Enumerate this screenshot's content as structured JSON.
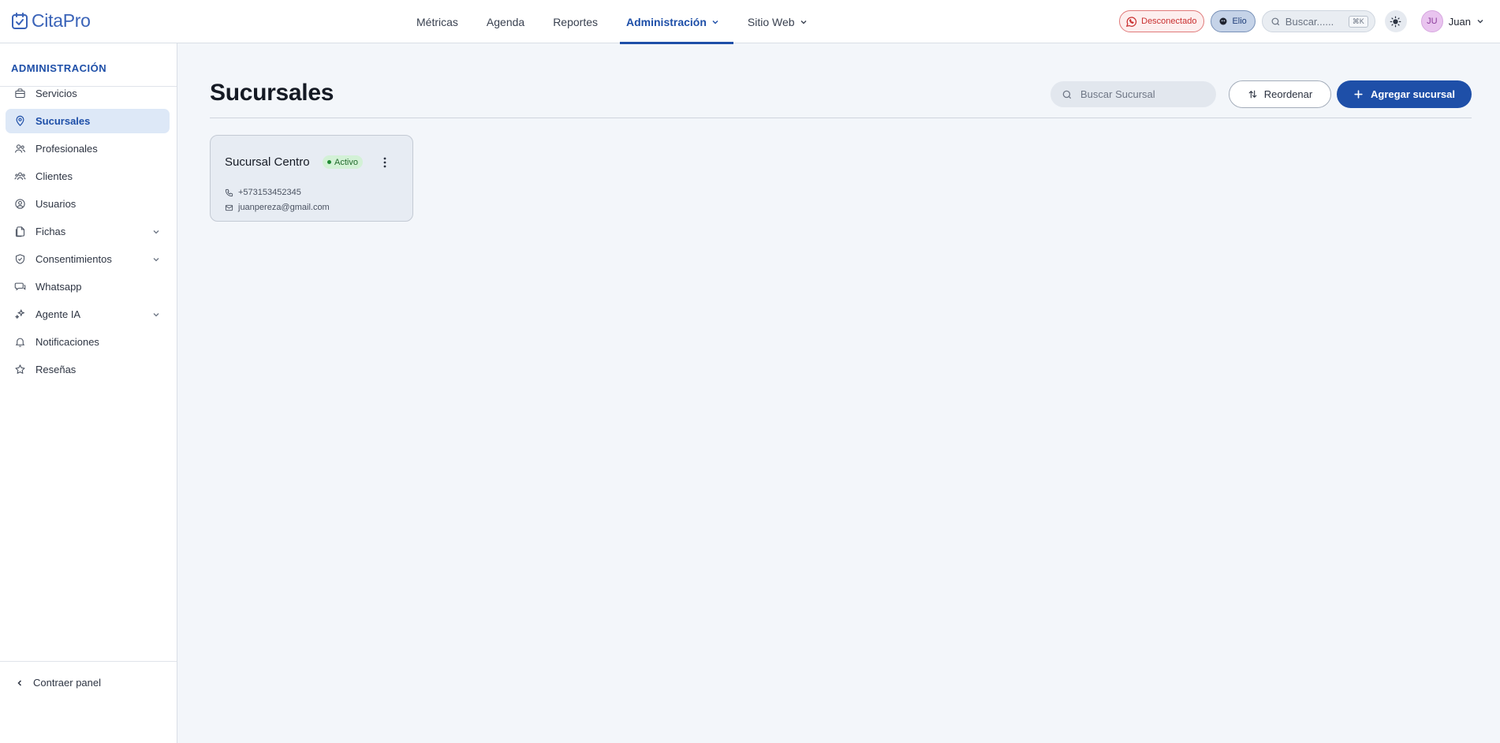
{
  "app": {
    "name": "CitaPro"
  },
  "nav": {
    "items": [
      {
        "label": "Métricas"
      },
      {
        "label": "Agenda"
      },
      {
        "label": "Reportes"
      },
      {
        "label": "Administración"
      },
      {
        "label": "Sitio Web"
      }
    ],
    "active": "Administración"
  },
  "topbar": {
    "whatsapp_status": "Desconectado",
    "assistant_label": "Elio",
    "search_placeholder": "Buscar......",
    "search_shortcut": "⌘K",
    "user_initials": "JU",
    "user_name": "Juan"
  },
  "sidebar": {
    "section_title": "ADMINISTRACIÓN",
    "items": [
      {
        "label": "Servicios",
        "icon": "box-icon"
      },
      {
        "label": "Sucursales",
        "icon": "map-pin-icon",
        "active": true
      },
      {
        "label": "Profesionales",
        "icon": "users-icon"
      },
      {
        "label": "Clientes",
        "icon": "contacts-icon"
      },
      {
        "label": "Usuarios",
        "icon": "user-circle-icon"
      },
      {
        "label": "Fichas",
        "icon": "files-icon",
        "expandable": true
      },
      {
        "label": "Consentimientos",
        "icon": "shield-check-icon",
        "expandable": true
      },
      {
        "label": "Whatsapp",
        "icon": "chat-icon"
      },
      {
        "label": "Agente IA",
        "icon": "sparkles-icon",
        "expandable": true
      },
      {
        "label": "Notificaciones",
        "icon": "bell-icon"
      },
      {
        "label": "Reseñas",
        "icon": "star-icon"
      }
    ],
    "collapse_label": "Contraer panel"
  },
  "main": {
    "title": "Sucursales",
    "search_placeholder": "Buscar Sucursal",
    "reorder_label": "Reordenar",
    "add_label": "Agregar sucursal",
    "branches": [
      {
        "name": "Sucursal Centro",
        "status": "Activo",
        "phone": "+573153452345",
        "email": "juanpereza@gmail.com"
      }
    ]
  },
  "colors": {
    "accent": "#1e4fa8",
    "active_badge_bg": "#d3f1d6",
    "disconnected": "#c93030"
  }
}
